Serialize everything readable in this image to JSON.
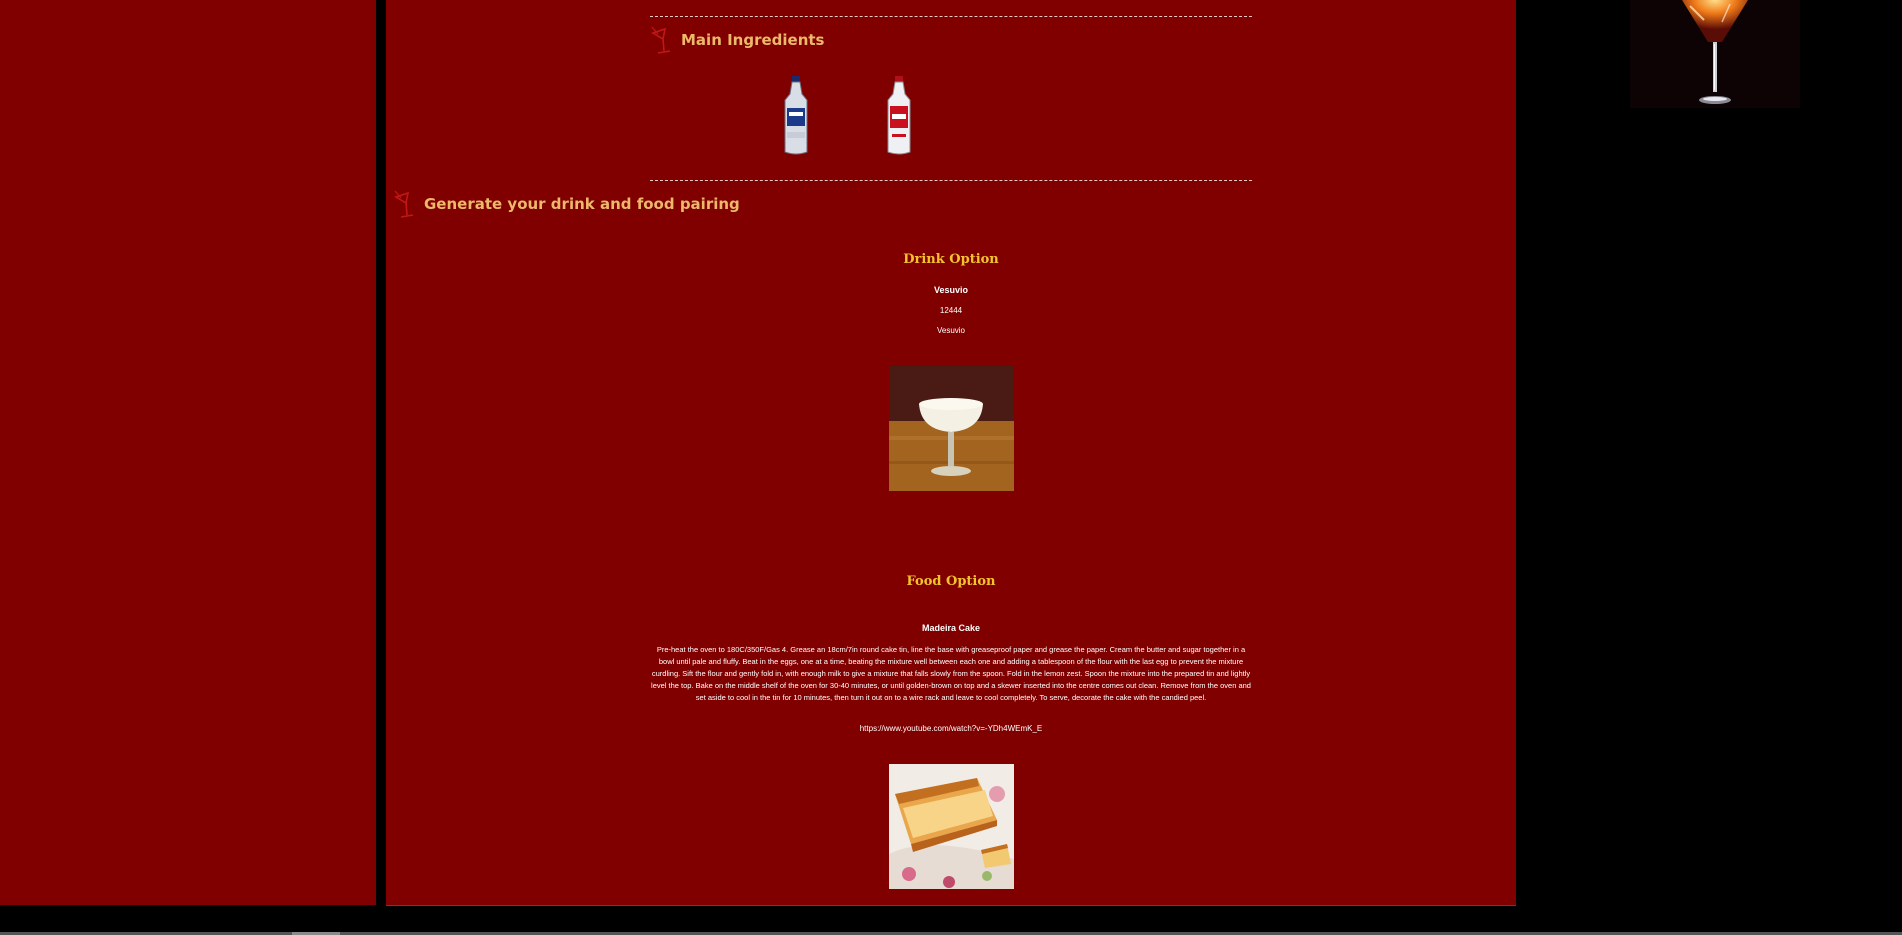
{
  "sections": {
    "ingredients_title": "Main Ingredients",
    "pairing_title": "Generate your drink and food pairing"
  },
  "drink": {
    "heading": "Drink Option",
    "name": "Vesuvio",
    "id": "12444",
    "alt_name": "Vesuvio"
  },
  "food": {
    "heading": "Food Option",
    "name": "Madeira Cake",
    "instructions": "Pre-heat the oven to 180C/350F/Gas 4. Grease an 18cm/7in round cake tin, line the base with greaseproof paper and grease the paper. Cream the butter and sugar together in a bowl until pale and fluffy. Beat in the eggs, one at a time, beating the mixture well between each one and adding a tablespoon of the flour with the last egg to prevent the mixture curdling. Sift the flour and gently fold in, with enough milk to give a mixture that falls slowly from the spoon. Fold in the lemon zest. Spoon the mixture into the prepared tin and lightly level the top. Bake on the middle shelf of the oven for 30-40 minutes, or until golden-brown on top and a skewer inserted into the centre comes out clean. Remove from the oven and set aside to cool in the tin for 10 minutes, then turn it out on to a wire rack and leave to cool completely. To serve, decorate the cake with the candied peel.",
    "video_link": "https://www.youtube.com/watch?v=-YDh4WEmK_E"
  },
  "icons": {
    "section_icon": "cocktail-glass-icon",
    "bottle_1": "vodka-bottle-blue-icon",
    "bottle_2": "vodka-bottle-red-icon"
  },
  "colors": {
    "background": "#800000",
    "section_title": "#ecb86a",
    "sub_title": "#f3c32e"
  }
}
